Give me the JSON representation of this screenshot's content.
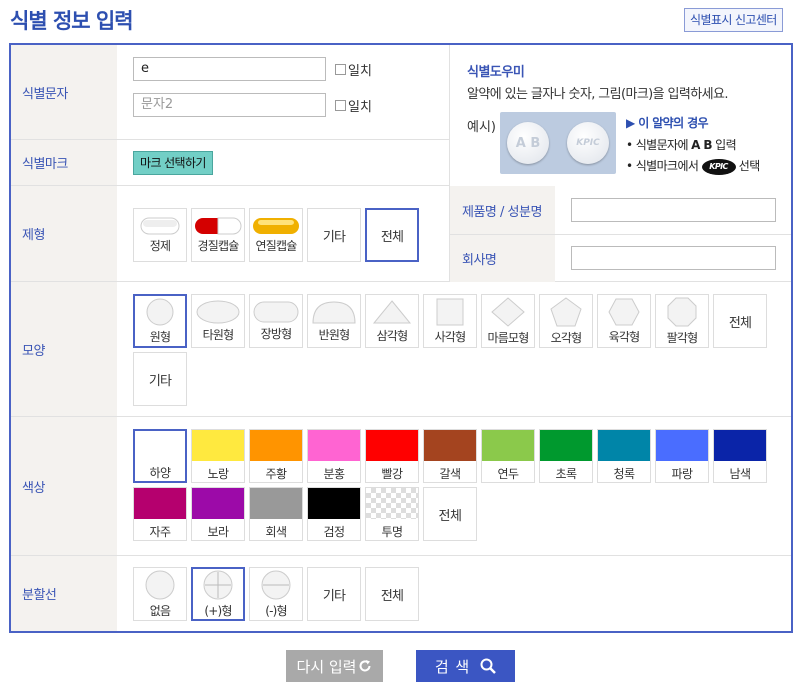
{
  "page_title": "식별 정보 입력",
  "report_button": "식별표시 신고센터",
  "rows": {
    "id_text": {
      "label": "식별문자",
      "input1_value": "e",
      "input2_placeholder": "문자2",
      "exact_match": "일치"
    },
    "id_mark": {
      "label": "식별마크",
      "button": "마크 선택하기"
    },
    "form_type": {
      "label": "제형",
      "options": [
        "정제",
        "경질캡슐",
        "연질캡슐",
        "기타",
        "전체"
      ],
      "selected": "전체"
    },
    "shape": {
      "label": "모양",
      "options": [
        "원형",
        "타원형",
        "장방형",
        "반원형",
        "삼각형",
        "사각형",
        "마름모형",
        "오각형",
        "육각형",
        "팔각형",
        "전체",
        "기타"
      ],
      "selected": "원형"
    },
    "color": {
      "label": "색상",
      "options": [
        {
          "name": "하양",
          "hex": "#ffffff"
        },
        {
          "name": "노랑",
          "hex": "#ffe93f"
        },
        {
          "name": "주황",
          "hex": "#ff9400"
        },
        {
          "name": "분홍",
          "hex": "#ff64d2"
        },
        {
          "name": "빨강",
          "hex": "#ff0000"
        },
        {
          "name": "갈색",
          "hex": "#a4441f"
        },
        {
          "name": "연두",
          "hex": "#8bc94b"
        },
        {
          "name": "초록",
          "hex": "#00992e"
        },
        {
          "name": "청록",
          "hex": "#0085a8"
        },
        {
          "name": "파랑",
          "hex": "#4a6dff"
        },
        {
          "name": "남색",
          "hex": "#0a24a8"
        },
        {
          "name": "자주",
          "hex": "#b5006e"
        },
        {
          "name": "보라",
          "hex": "#9c0aa8"
        },
        {
          "name": "회색",
          "hex": "#999999"
        },
        {
          "name": "검정",
          "hex": "#000000"
        },
        {
          "name": "투명",
          "hex": "transparent"
        },
        {
          "name": "전체",
          "hex": ""
        }
      ],
      "selected": "하양"
    },
    "score_line": {
      "label": "분할선",
      "options": [
        "없음",
        "(+)형",
        "(-)형",
        "기타",
        "전체"
      ],
      "selected": "(+)형"
    }
  },
  "help": {
    "title": "식별도우미",
    "desc": "알약에 있는 글자나 숫자, 그림(마크)을 입력하세요.",
    "example_label": "예시)",
    "sample_text1": "A B",
    "sample_text2": "KPIC",
    "case_title": "▶ 이 알약의 경우",
    "case_line1_prefix": "• 식별문자에",
    "case_line1_bold": "A B",
    "case_line1_suffix": "입력",
    "case_line2_prefix": "• 식별마크에서",
    "case_line2_logo": "KPIC",
    "case_line2_suffix": "선택"
  },
  "product_name": {
    "label": "제품명 / 성분명",
    "value": ""
  },
  "company_name": {
    "label": "회사명",
    "value": ""
  },
  "buttons": {
    "reset": "다시 입력",
    "search": "검 색"
  },
  "colors": {
    "accent": "#4a62c5",
    "reset_bg": "#a9a9a9",
    "search_bg": "#3b56c3"
  }
}
